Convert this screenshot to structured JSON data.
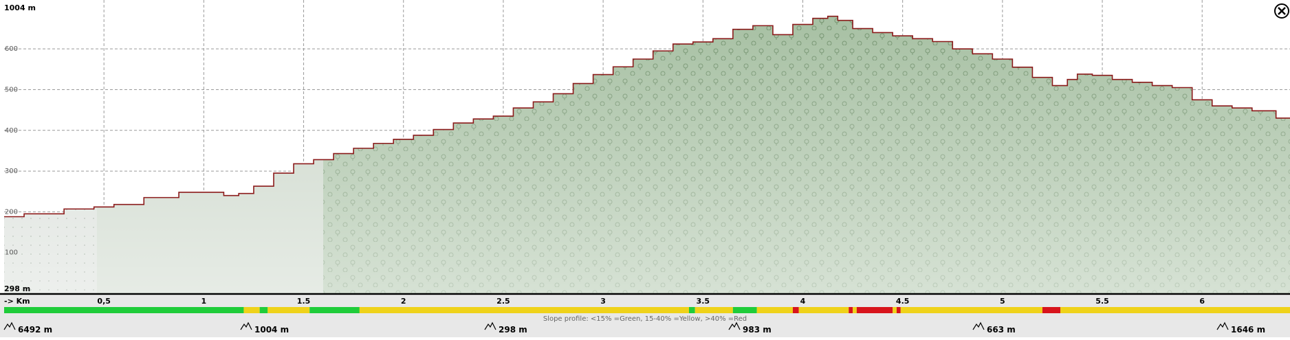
{
  "chart_data": {
    "type": "area",
    "title": "",
    "xlabel": "-> Km",
    "ylabel": "",
    "ylim": [
      0,
      720
    ],
    "xlim": [
      0,
      6.44
    ],
    "grid": true,
    "x_ticks": [
      0.5,
      1,
      1.5,
      2,
      2.5,
      3,
      3.5,
      4,
      4.5,
      5,
      5.5,
      6
    ],
    "x_tick_labels": [
      "0,5",
      "1",
      "1.5",
      "2",
      "2.5",
      "3",
      "3.5",
      "4",
      "4.5",
      "5",
      "5.5",
      "6"
    ],
    "y_ticks": [
      100,
      200,
      300,
      400,
      500,
      600
    ],
    "y_tick_labels": [
      "100",
      "200",
      "300",
      "400",
      "500",
      "600"
    ],
    "max_label": "1004 m",
    "min_label": "298 m",
    "series": [
      {
        "x": [
          0,
          0.2,
          0.4,
          0.5,
          0.6,
          0.8,
          0.95,
          1.05,
          1.15,
          1.2,
          1.3,
          1.4,
          1.5,
          1.6,
          1.7,
          1.8,
          1.9,
          2.0,
          2.1,
          2.2,
          2.3,
          2.4,
          2.5,
          2.6,
          2.7,
          2.8,
          2.9,
          3.0,
          3.1,
          3.2,
          3.3,
          3.4,
          3.5,
          3.6,
          3.7,
          3.8,
          3.9,
          4.0,
          4.1,
          4.15,
          4.2,
          4.3,
          4.4,
          4.5,
          4.6,
          4.7,
          4.8,
          4.9,
          5.0,
          5.1,
          5.2,
          5.3,
          5.35,
          5.4,
          5.5,
          5.6,
          5.7,
          5.8,
          5.9,
          6.0,
          6.1,
          6.2,
          6.3,
          6.44
        ],
        "values": [
          188,
          195,
          207,
          212,
          218,
          235,
          248,
          248,
          240,
          245,
          263,
          295,
          318,
          328,
          343,
          356,
          368,
          378,
          388,
          402,
          418,
          428,
          435,
          455,
          470,
          490,
          515,
          537,
          556,
          575,
          595,
          612,
          617,
          625,
          648,
          657,
          635,
          660,
          675,
          680,
          670,
          650,
          640,
          632,
          625,
          618,
          600,
          588,
          575,
          555,
          530,
          510,
          525,
          538,
          535,
          525,
          518,
          510,
          505,
          475,
          460,
          455,
          448,
          430
        ]
      }
    ],
    "slope_bar": {
      "label": "Slope profile: <15% =Green, 15-40% =Yellow, >40% =Red",
      "colors": {
        "green": "#1fcc3a",
        "yellow": "#efd21a",
        "red": "#d8141c"
      },
      "segments": [
        {
          "from": 0.0,
          "to": 1.2,
          "color": "green"
        },
        {
          "from": 1.2,
          "to": 1.28,
          "color": "yellow"
        },
        {
          "from": 1.28,
          "to": 1.32,
          "color": "green"
        },
        {
          "from": 1.32,
          "to": 1.53,
          "color": "yellow"
        },
        {
          "from": 1.53,
          "to": 1.78,
          "color": "green"
        },
        {
          "from": 1.78,
          "to": 3.43,
          "color": "yellow"
        },
        {
          "from": 3.43,
          "to": 3.46,
          "color": "green"
        },
        {
          "from": 3.46,
          "to": 3.65,
          "color": "yellow"
        },
        {
          "from": 3.65,
          "to": 3.77,
          "color": "green"
        },
        {
          "from": 3.77,
          "to": 3.95,
          "color": "yellow"
        },
        {
          "from": 3.95,
          "to": 3.98,
          "color": "red"
        },
        {
          "from": 3.98,
          "to": 4.23,
          "color": "yellow"
        },
        {
          "from": 4.23,
          "to": 4.25,
          "color": "red"
        },
        {
          "from": 4.25,
          "to": 4.27,
          "color": "yellow"
        },
        {
          "from": 4.27,
          "to": 4.45,
          "color": "red"
        },
        {
          "from": 4.45,
          "to": 4.47,
          "color": "yellow"
        },
        {
          "from": 4.47,
          "to": 4.49,
          "color": "red"
        },
        {
          "from": 4.49,
          "to": 5.2,
          "color": "yellow"
        },
        {
          "from": 5.2,
          "to": 5.29,
          "color": "red"
        },
        {
          "from": 5.29,
          "to": 6.44,
          "color": "yellow"
        }
      ]
    },
    "footer_stats": [
      {
        "icon": "distance-icon",
        "text": "6492 m"
      },
      {
        "icon": "max-altitude-icon",
        "text": "1004 m"
      },
      {
        "icon": "min-altitude-icon",
        "text": "298 m"
      },
      {
        "icon": "ascent-icon",
        "text": "983 m"
      },
      {
        "icon": "descent-icon",
        "text": "663 m"
      },
      {
        "icon": "climb-icon",
        "text": "1646 m"
      }
    ],
    "colors": {
      "line": "#8b1a1a",
      "fill": "#8fb48a",
      "grid": "#999999"
    }
  }
}
